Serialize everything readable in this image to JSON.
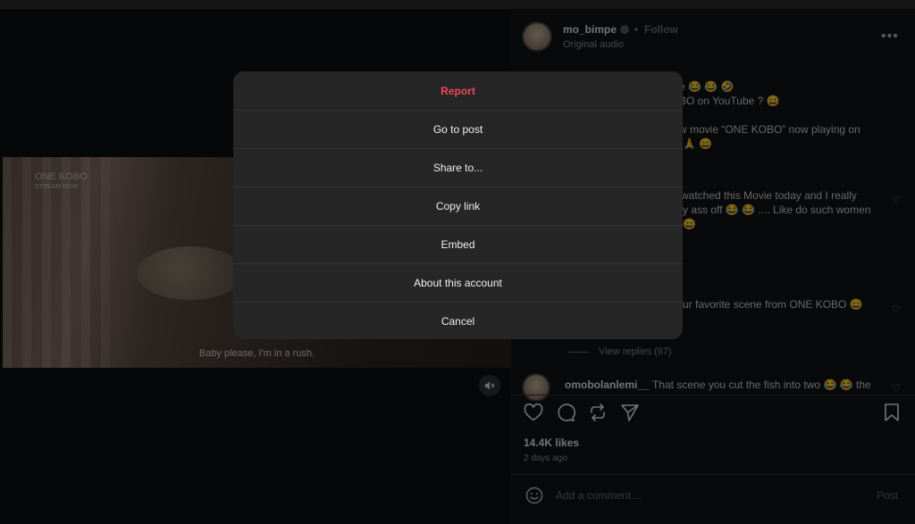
{
  "post": {
    "username": "mo_bimpe",
    "dot": "•",
    "follow_label": "Follow",
    "audio_label": "Original audio",
    "more_label": "•••"
  },
  "video": {
    "watermark": "ONE KOBO",
    "watermark_sub": "STREAM NOW",
    "subtitle": "Baby please, I'm in a rush."
  },
  "comments": {
    "line1": "e 😂 😂 🤣",
    "line2": "BO on YouTube ? 😄",
    "line3": "w movie “ONE KOBO” now playing on",
    "line4": "🙏 😄",
    "line5": "watched this Movie today and I really",
    "line6": "y ass off 😂 😂 .... Like do such women",
    "line7": "😄",
    "line8": "ur favorite scene from ONE KOBO 😄",
    "view_replies": "View replies (67)",
    "last_user": "omobolanlemi__",
    "last_text": "That scene you cut the fish into two 😂 😂  the"
  },
  "stats": {
    "likes": "14.4K likes",
    "time_ago": "2 days ago"
  },
  "composer": {
    "placeholder": "Add a comment…",
    "post_label": "Post"
  },
  "menu": {
    "items": [
      "Report",
      "Go to post",
      "Share to...",
      "Copy link",
      "Embed",
      "About this account",
      "Cancel"
    ]
  },
  "colors": {
    "danger": "#ed4956",
    "menu_bg": "#262626",
    "panel_bg": "#111317"
  }
}
